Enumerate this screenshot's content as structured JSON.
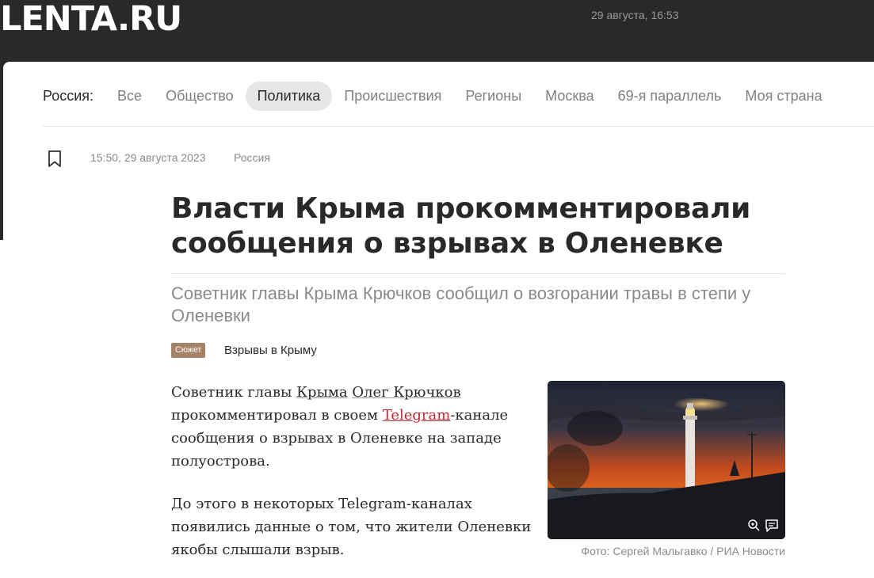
{
  "header": {
    "logo": "LENTA.RU",
    "datetime": "29 августа, 16:53"
  },
  "nav": {
    "label": "Россия:",
    "items": [
      "Все",
      "Общество",
      "Политика",
      "Происшествия",
      "Регионы",
      "Москва",
      "69-я параллель",
      "Моя страна"
    ],
    "active": "Политика"
  },
  "article": {
    "time": "15:50, 29 августа 2023",
    "rubric": "Россия",
    "title": "Власти Крыма прокомментировали сообщения о взрывах в Оленевке",
    "subtitle": "Советник главы Крыма Крючков сообщил о возгорании травы в степи у Оленевки",
    "story_badge": "Сюжет",
    "story_title": "Взрывы в Крыму",
    "p1": {
      "t1": "Советник главы ",
      "link1": "Крыма",
      "t2": " ",
      "link2": "Олег Крючков",
      "t3": " прокомментировал в своем ",
      "link3": "Telegram",
      "t4": "-каналe сообщения о взрывах в Оленевке на западе полуострова."
    },
    "p2": "До этого в некоторых Telegram-каналах появились данные о том, что жители Оленевки якобы слышали взрыв.",
    "photo_caption": "Фото: Сергей Мальгавко / РИА Новости"
  },
  "icons": {
    "bookmark": "bookmark-icon",
    "zoom": "zoom-in-icon",
    "comment": "comment-icon"
  },
  "colors": {
    "header_bg": "#292929",
    "accent_red": "#c1272d",
    "story_badge": "#a68267",
    "muted_text": "#8a8a8a"
  }
}
